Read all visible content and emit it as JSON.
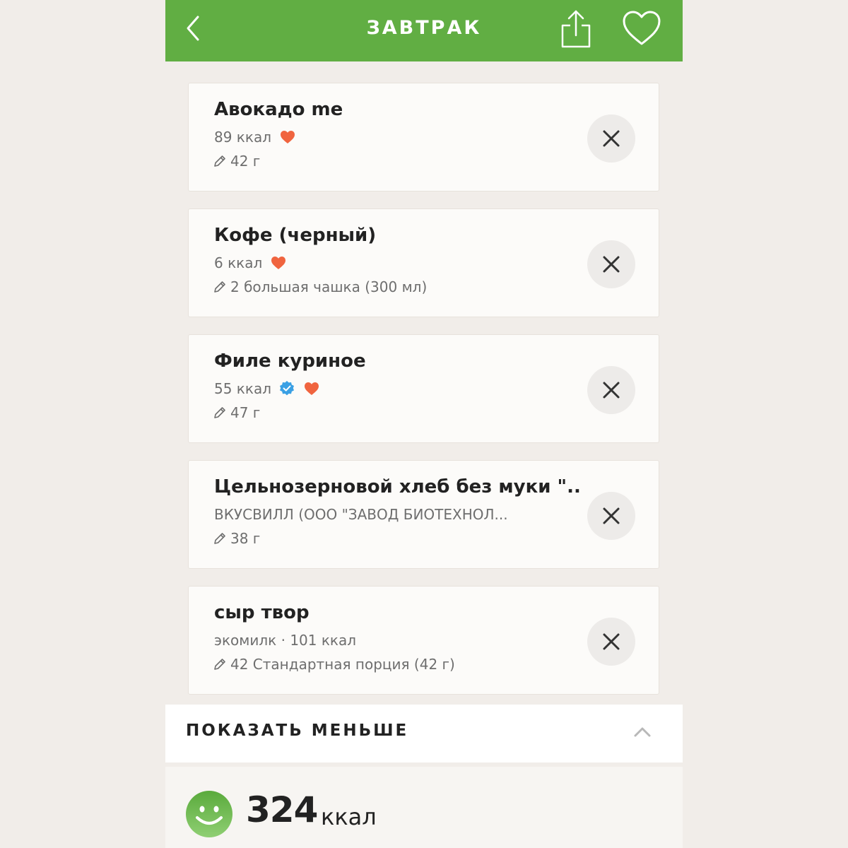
{
  "header": {
    "title": "ЗАВТРАК",
    "back_icon": "chevron-left-icon",
    "share_icon": "share-icon",
    "favorite_icon": "heart-outline-icon",
    "background_color": "#61ae43"
  },
  "items": [
    {
      "name": "Авокадо me",
      "line2": "89 ккал",
      "favorite": true,
      "verified": false,
      "portion": "42 г"
    },
    {
      "name": "Кофе (черный)",
      "line2": "6 ккал",
      "favorite": true,
      "verified": false,
      "portion": "2 большая чашка (300 мл)"
    },
    {
      "name": "Филе куриное",
      "line2": "55 ккал",
      "favorite": true,
      "verified": true,
      "portion": "47 г"
    },
    {
      "name": "Цельнозерновой хлеб без муки  \"...",
      "line2": "ВКУСВИЛЛ (ООО \"ЗАВОД БИОТЕХНОЛ...",
      "favorite": false,
      "verified": false,
      "portion": "38 г"
    },
    {
      "name": "сыр твор",
      "line2": "экомилк · 101 ккал",
      "favorite": false,
      "verified": false,
      "portion": "42 Стандартная порция (42 г)"
    }
  ],
  "show_less": {
    "label": "ПОКАЗАТЬ МЕНЬШЕ",
    "icon": "chevron-up-icon"
  },
  "summary": {
    "total": "324",
    "unit": "ккал",
    "icon": "smiley-icon"
  },
  "colors": {
    "accent_green": "#61ae43",
    "heart_red": "#f0643f",
    "verified_blue": "#3aa0e4"
  }
}
